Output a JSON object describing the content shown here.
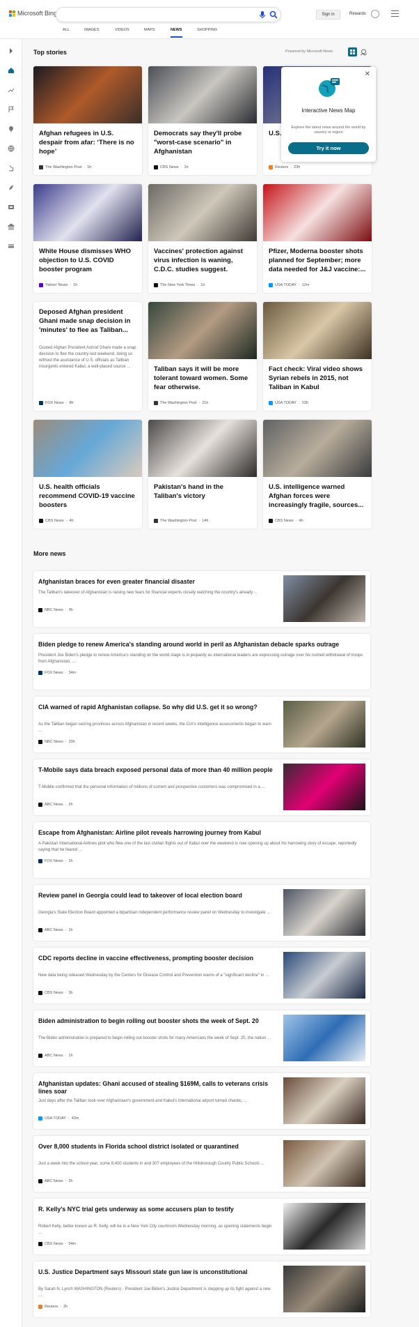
{
  "header": {
    "brand": "Microsoft Bing",
    "search": {
      "value": "",
      "placeholder": ""
    },
    "signin": "Sign in",
    "rewards": "Rewards"
  },
  "tabs": [
    {
      "label": "ALL",
      "active": false
    },
    {
      "label": "IMAGES",
      "active": false
    },
    {
      "label": "VIDEOS",
      "active": false
    },
    {
      "label": "MAPS",
      "active": false
    },
    {
      "label": "NEWS",
      "active": true
    },
    {
      "label": "SHOPPING",
      "active": false
    }
  ],
  "sidebar": {
    "icons": [
      "collapse-arrow-icon",
      "home-icon",
      "trending-icon",
      "flag-icon",
      "map-pin-icon",
      "globe-icon",
      "microscope-icon",
      "rocket-icon",
      "film-icon",
      "politics-icon",
      "money-icon"
    ]
  },
  "top_stories": {
    "title": "Top stories",
    "powered": "Powered by Microsoft News",
    "cards": [
      {
        "title": "Afghan refugees in U.S. despair from afar: ‘There is no hope’",
        "source": "The Washington Post",
        "time": "1h",
        "icon_color": "#333333",
        "img": [
          "#1c1b24",
          "#b05a2a",
          "#3a2f2a"
        ]
      },
      {
        "title": "Democrats say they'll probe \"worst-case scenario\" in Afghanistan",
        "source": "CBS News",
        "time": "1h",
        "icon_color": "#111111",
        "img": [
          "#4b4f57",
          "#c9c6c0",
          "#2b2d33"
        ]
      },
      {
        "title": "U.S. ... of Ka... staff",
        "source": "Reuters",
        "time": "23h",
        "icon_color": "#f47b20",
        "img": [
          "#232f7a",
          "#6d7190",
          "#1c2150"
        ]
      },
      {
        "title": "White House dismisses WHO objection to U.S. COVID booster program",
        "source": "Yahoo! News",
        "time": "1h",
        "icon_color": "#6001d2",
        "img": [
          "#3c3c8c",
          "#e1e1ef",
          "#22224e"
        ]
      },
      {
        "title": "Vaccines' protection against virus infection is waning, C.D.C. studies suggest.",
        "source": "The New York Times",
        "time": "1h",
        "icon_color": "#111111",
        "img": [
          "#6c6a66",
          "#cfc7b9",
          "#3f3b36"
        ]
      },
      {
        "title": "Pfizer, Moderna booster shots planned for September; more data needed for J&J vaccine:...",
        "source": "USA TODAY",
        "time": "12m",
        "icon_color": "#009bff",
        "img": [
          "#c5151b",
          "#f5e0df",
          "#7d0d10"
        ]
      },
      {
        "title": "Deposed Afghan president Ghani made snap decision in 'minutes' to flee as Taliban...",
        "desc": "Ousted Afghan President Ashraf Ghani made a snap decision to flee the country last weekend, doing so without the assistance of U.S. officials as Taliban insurgents entered Kabul, a well-placed source ...",
        "source": "FOX News",
        "time": "8h",
        "icon_color": "#003366"
      },
      {
        "title": "Taliban says it will be more tolerant toward women. Some fear otherwise.",
        "source": "The Washington Post",
        "time": "21h",
        "icon_color": "#333333",
        "img": [
          "#35473d",
          "#b49b83",
          "#1d2922"
        ]
      },
      {
        "title": "Fact check: Viral video shows Syrian rebels in 2015, not Taliban in Kabul",
        "source": "USA TODAY",
        "time": "23h",
        "icon_color": "#009bff",
        "img": [
          "#6b5a3e",
          "#d9c7a6",
          "#3c3122"
        ]
      },
      {
        "title": "U.S. health officials recommend COVID-19 vaccine boosters",
        "source": "CBS News",
        "time": "4h",
        "icon_color": "#111111",
        "img": [
          "#9c8c7c",
          "#66a8d8",
          "#d9cbbd"
        ]
      },
      {
        "title": "Pakistan's hand in the Taliban's victory",
        "source": "The Washington Post",
        "time": "14h",
        "icon_color": "#333333",
        "img": [
          "#4c4a4a",
          "#e6e1dc",
          "#2e2b29"
        ]
      },
      {
        "title": "U.S. intelligence warned Afghan forces were increasingly fragile, sources...",
        "source": "CBS News",
        "time": "4h",
        "icon_color": "#111111",
        "img": [
          "#5f6263",
          "#b8ad9c",
          "#3a3c3d"
        ]
      }
    ]
  },
  "popup": {
    "title": "Interactive News Map",
    "text": "Explore the latest news around the world by country or region",
    "button": "Try it now"
  },
  "more_news": {
    "title": "More news",
    "items": [
      {
        "title": "Afghanistan braces for even greater financial disaster",
        "desc": "The Taliban's takeover of Afghanistan is raising new fears for financial experts closely watching the country's already ...",
        "source": "NBC News",
        "time": "9h",
        "icon_color": "#111111",
        "img": [
          "#7f8ea3",
          "#3b3530",
          "#c0b7ad"
        ]
      },
      {
        "title": "Biden pledge to renew America's standing around world in peril as Afghanistan debacle sparks outrage",
        "desc": "President Joe Biden's pledge to renew America's standing on the world stage is in jeopardy as international leaders are expressing outrage over his rushed withdrawal of troops from Afghanistan, ...",
        "source": "FOX News",
        "time": "34m",
        "icon_color": "#003366"
      },
      {
        "title": "CIA warned of rapid Afghanistan collapse. So why did U.S. get it so wrong?",
        "desc": "As the Taliban began seizing provinces across Afghanistan in recent weeks, the CIA's intelligence assessments began to warn ...",
        "source": "NBC News",
        "time": "20h",
        "icon_color": "#111111",
        "img": [
          "#5a5e46",
          "#b4a58d",
          "#2f3224"
        ]
      },
      {
        "title": "T-Mobile says data breach exposed personal data of more than 40 million people",
        "desc": "T-Mobile confirmed that the personal information of millions of current and prospective customers was compromised in a ...",
        "source": "ABC News",
        "time": "2h",
        "icon_color": "#111111",
        "img": [
          "#3a2a33",
          "#e20074",
          "#1b1418"
        ]
      },
      {
        "title": "Escape from Afghanistan: Airline pilot reveals harrowing journey from Kabul",
        "desc": "A Pakistan International Airlines pilot who flew one of the last civilian flights out of Kabul over the weekend is now opening up about his harrowing story of escape, reportedly saying that he feared ...",
        "source": "FOX News",
        "time": "1h",
        "icon_color": "#003366"
      },
      {
        "title": "Review panel in Georgia could lead to takeover of local election board",
        "desc": "Georgia's State Election Board appointed a bipartisan independent performance review panel on Wednesday to investigate ...",
        "source": "ABC News",
        "time": "1h",
        "icon_color": "#111111",
        "img": [
          "#4d5564",
          "#d8d4cc",
          "#2d2f35"
        ]
      },
      {
        "title": "CDC reports decline in vaccine effectiveness, prompting booster decision",
        "desc": "New data being released Wednesday by the Centers for Disease Control and Prevention warns of a \"significant decline\" in ...",
        "source": "CBS News",
        "time": "3h",
        "icon_color": "#111111",
        "img": [
          "#2b4a7a",
          "#c8ccd2",
          "#1b2a44"
        ]
      },
      {
        "title": "Biden administration to begin rolling out booster shots the week of Sept. 20",
        "desc": "The Biden administration is prepared to begin rolling out booster shots for many Americans the week of Sept. 20, the nation ...",
        "source": "ABC News",
        "time": "1h",
        "icon_color": "#111111",
        "img": [
          "#9fc4e8",
          "#2f6db5",
          "#e7eef6"
        ]
      },
      {
        "title": "Afghanistan updates: Ghani accused of stealing $169M, calls to veterans crisis lines soar",
        "desc": "Just days after the Taliban took over Afghanistan's government and Kabul's international airport turned chaotic, ...",
        "source": "USA TODAY",
        "time": "43m",
        "icon_color": "#009bff",
        "img": [
          "#6a4d3a",
          "#d9cfc1",
          "#3a2a20"
        ]
      },
      {
        "title": "Over 8,000 students in Florida school district isolated or quarantined",
        "desc": "Just a week into the school year, some 8,400 students in and 307 employees of the Hillsborough County Public Schools ...",
        "source": "ABC News",
        "time": "2h",
        "icon_color": "#111111",
        "img": [
          "#7a5a40",
          "#cfc2b0",
          "#3a2b20"
        ]
      },
      {
        "title": "R. Kelly's NYC trial gets underway as some accusers plan to testify",
        "desc": "Robert Kelly, better known as R. Kelly, will be in a New York City courtroom Wednesday morning, as opening statements begin ...",
        "source": "CBS News",
        "time": "54m",
        "icon_color": "#111111",
        "img": [
          "#f1f1f1",
          "#2a2a2a",
          "#cfcfcf"
        ]
      },
      {
        "title": "U.S. Justice Department says Missouri state gun law is unconstitutional",
        "desc": "By Sarah N. Lynch WASHINGTON (Reuters) - President Joe Biden's Justice Department is stepping up its fight against a new ...",
        "source": "Reuters",
        "time": "2h",
        "icon_color": "#f47b20",
        "img": [
          "#3a3a3a",
          "#9a8c7a",
          "#1d1d1d"
        ]
      }
    ]
  },
  "colors": {
    "accent": "#174ae4",
    "cta": "#0a6e8a"
  }
}
